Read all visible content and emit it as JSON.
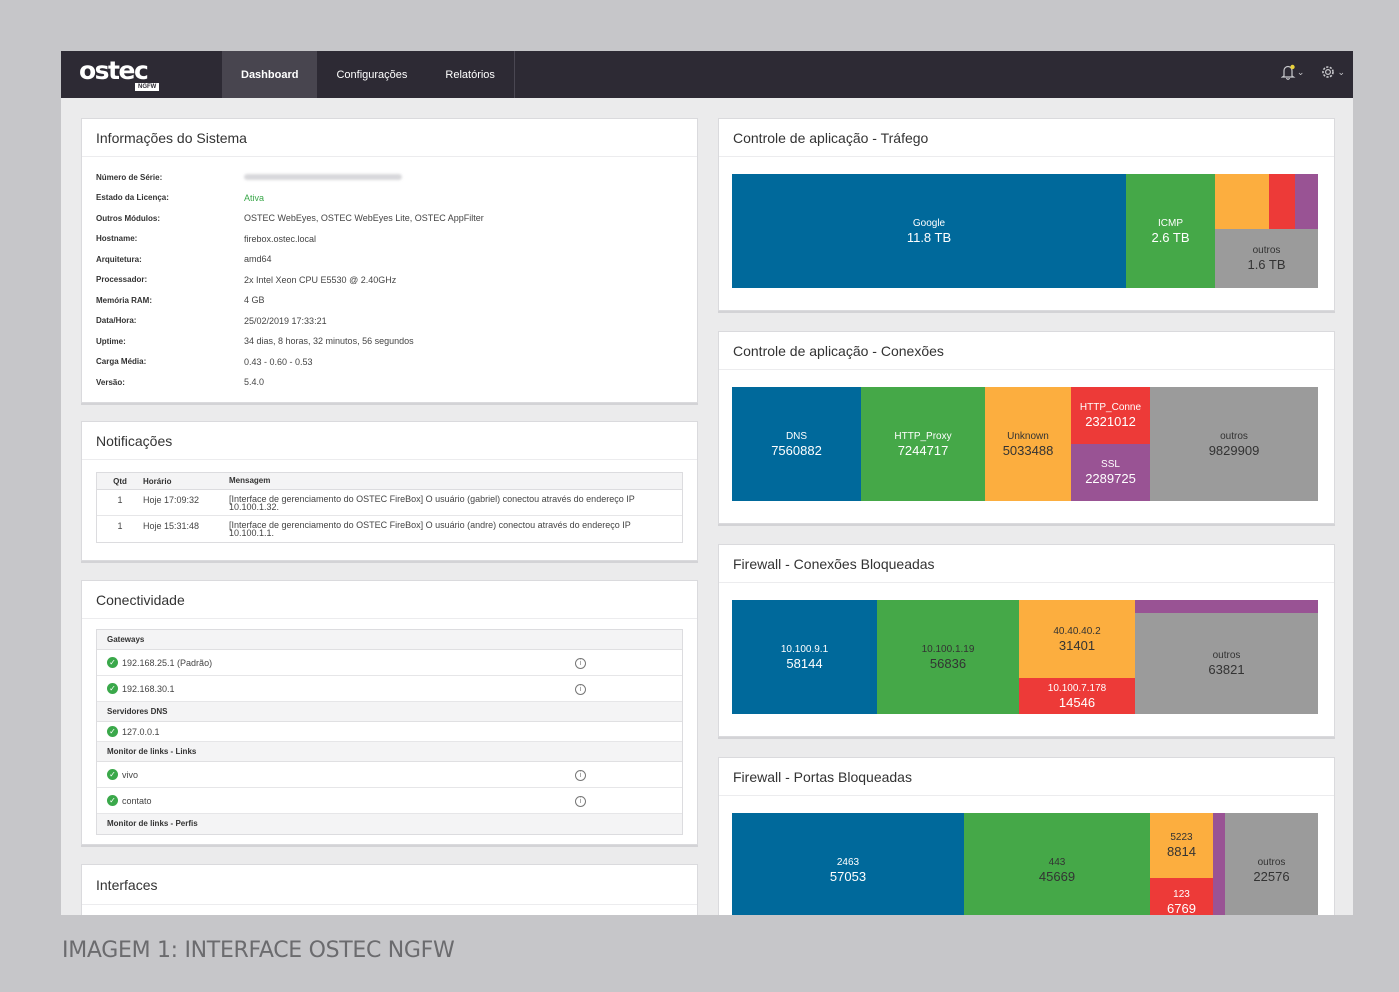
{
  "header": {
    "logo_text": "ostec",
    "logo_badge": "NGFW",
    "tabs": [
      {
        "label": "Dashboard"
      },
      {
        "label": "Configurações"
      },
      {
        "label": "Relatórios"
      }
    ],
    "icons": [
      "bell-icon",
      "gear-icon"
    ]
  },
  "system_info": {
    "title": "Informações do Sistema",
    "rows": [
      {
        "label": "Número de Série:",
        "value": ""
      },
      {
        "label": "Estado da Licença:",
        "value": "Ativa"
      },
      {
        "label": "Outros Módulos:",
        "value": "OSTEC WebEyes, OSTEC WebEyes Lite, OSTEC AppFilter"
      },
      {
        "label": "Hostname:",
        "value": "firebox.ostec.local"
      },
      {
        "label": "Arquitetura:",
        "value": "amd64"
      },
      {
        "label": "Processador:",
        "value": "2x Intel Xeon CPU E5530 @ 2.40GHz"
      },
      {
        "label": "Memória RAM:",
        "value": "4 GB"
      },
      {
        "label": "Data/Hora:",
        "value": "25/02/2019 17:33:21"
      },
      {
        "label": "Uptime:",
        "value": "34 dias, 8 horas, 32 minutos, 56 segundos"
      },
      {
        "label": "Carga Média:",
        "value": "0.43 - 0.60 - 0.53"
      },
      {
        "label": "Versão:",
        "value": "5.4.0"
      }
    ]
  },
  "notifications": {
    "title": "Notificações",
    "headers": [
      "Qtd",
      "Horário",
      "Mensagem"
    ],
    "rows": [
      {
        "qtd": "1",
        "time": "Hoje 17:09:32",
        "msg": "[Interface de gerenciamento do OSTEC FireBox] O usuário (gabriel) conectou através do endereço IP 10.100.1.32."
      },
      {
        "qtd": "1",
        "time": "Hoje 15:31:48",
        "msg": "[Interface de gerenciamento do OSTEC FireBox] O usuário (andre) conectou através do endereço IP 10.100.1.1."
      }
    ]
  },
  "connectivity": {
    "title": "Conectividade",
    "gateways_label": "Gateways",
    "gateways": [
      "192.168.25.1 (Padrão)",
      "192.168.30.1"
    ],
    "dns_label": "Servidores DNS",
    "dns": [
      "127.0.0.1"
    ],
    "links_label": "Monitor de links - Links",
    "links": [
      "vivo",
      "contato"
    ],
    "profiles_label": "Monitor de links - Perfis"
  },
  "interfaces": {
    "title": "Interfaces"
  },
  "app_traffic": {
    "title": "Controle de aplicação - Tráfego",
    "cells": [
      {
        "name": "Google",
        "value": "11.8 TB"
      },
      {
        "name": "ICMP",
        "value": "2.6 TB"
      },
      {
        "name": "outros",
        "value": "1.6 TB"
      }
    ]
  },
  "app_connections": {
    "title": "Controle de aplicação - Conexões",
    "cells": [
      {
        "name": "DNS",
        "value": "7560882"
      },
      {
        "name": "HTTP_Proxy",
        "value": "7244717"
      },
      {
        "name": "Unknown",
        "value": "5033488"
      },
      {
        "name": "HTTP_Conne",
        "value": "2321012"
      },
      {
        "name": "SSL",
        "value": "2289725"
      },
      {
        "name": "outros",
        "value": "9829909"
      }
    ]
  },
  "fw_blocked_conn": {
    "title": "Firewall - Conexões Bloqueadas",
    "cells": [
      {
        "name": "10.100.9.1",
        "value": "58144"
      },
      {
        "name": "10.100.1.19",
        "value": "56836"
      },
      {
        "name": "40.40.40.2",
        "value": "31401"
      },
      {
        "name": "10.100.7.178",
        "value": "14546"
      },
      {
        "name": "outros",
        "value": "63821"
      }
    ]
  },
  "fw_blocked_ports": {
    "title": "Firewall - Portas Bloqueadas",
    "cells": [
      {
        "name": "2463",
        "value": "57053"
      },
      {
        "name": "443",
        "value": "45669"
      },
      {
        "name": "5223",
        "value": "8814"
      },
      {
        "name": "123",
        "value": "6769"
      },
      {
        "name": "outros",
        "value": "22576"
      }
    ]
  },
  "colors": {
    "blue": "#00699b",
    "green": "#45a848",
    "orange": "#fcae3f",
    "red": "#ed3a38",
    "purple": "#995394",
    "grey": "#9b9b9b",
    "topbar": "#2d2a34",
    "status_ok": "#3aa84a"
  },
  "caption": "IMAGEM 1: INTERFACE OSTEC NGFW"
}
